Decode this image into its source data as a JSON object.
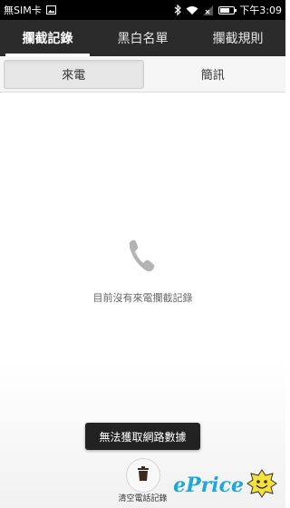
{
  "status_bar": {
    "carrier": "無SIM卡",
    "time": "下午3:09",
    "icons": [
      "image-icon",
      "bluetooth-icon",
      "wifi-icon",
      "no-signal-icon",
      "battery-icon"
    ]
  },
  "top_tabs": [
    {
      "label": "攔截記錄",
      "active": true
    },
    {
      "label": "黑白名單",
      "active": false
    },
    {
      "label": "攔截規則",
      "active": false
    }
  ],
  "segment_tabs": [
    {
      "label": "來電",
      "active": true
    },
    {
      "label": "簡訊",
      "active": false
    }
  ],
  "empty_state": {
    "icon": "phone-icon",
    "message": "目前沒有來電攔截記錄"
  },
  "toast": {
    "message": "無法獲取網路數據"
  },
  "bottom_action": {
    "icon": "trash-icon",
    "label": "清空電話記錄"
  },
  "watermark": {
    "text": "ePrice"
  },
  "colors": {
    "status_bar_bg": "#000000",
    "top_tabs_bg": "#2b2b2b",
    "watermark": "#1ea7d8"
  }
}
